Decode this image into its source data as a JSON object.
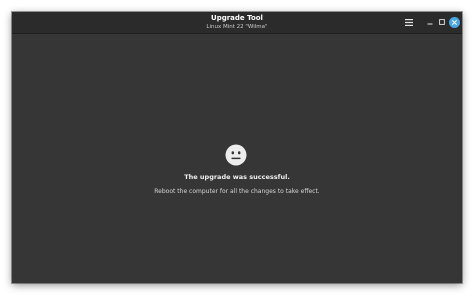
{
  "window": {
    "title": "Upgrade Tool",
    "subtitle": "Linux Mint 22 \"Wilma\""
  },
  "titlebar_buttons": {
    "menu_icon": "hamburger-menu-icon",
    "minimize_icon": "minimize-icon",
    "maximize_icon": "maximize-icon",
    "close_icon": "close-icon"
  },
  "status": {
    "icon": "neutral-face-icon",
    "heading": "The upgrade was successful.",
    "message": "Reboot the computer for all the changes to take effect."
  },
  "colors": {
    "background": "#363636",
    "titlebar": "#2b2b2b",
    "close_button": "#4aa6e0",
    "text_primary": "#f0f0f0"
  }
}
